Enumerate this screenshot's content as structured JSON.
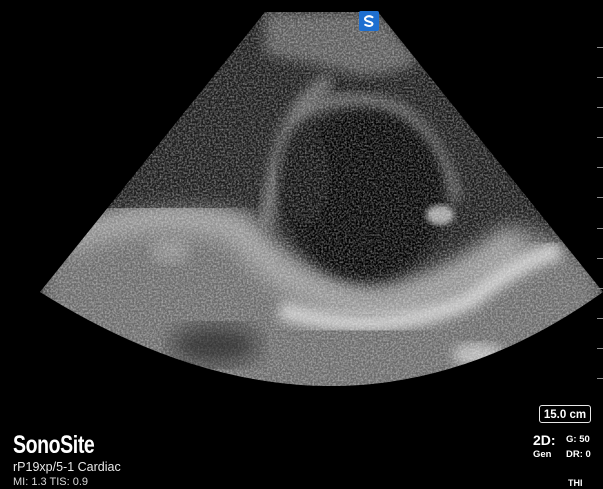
{
  "brand": "SonoSite",
  "probe_preset": "rP19xp/5-1  Cardiac",
  "indices": "MI: 1.3  TIS: 0.9",
  "depth_label": "15.0 cm",
  "mode": "2D:",
  "mode_sub": "Gen",
  "gain": "G: 50",
  "dynamic_range": "DR: 0",
  "thi": "THI",
  "logo_icon": "sonosite-logo-icon",
  "colors": {
    "background": "#000000",
    "logo": "#1e6fd0",
    "text": "#ffffff"
  }
}
